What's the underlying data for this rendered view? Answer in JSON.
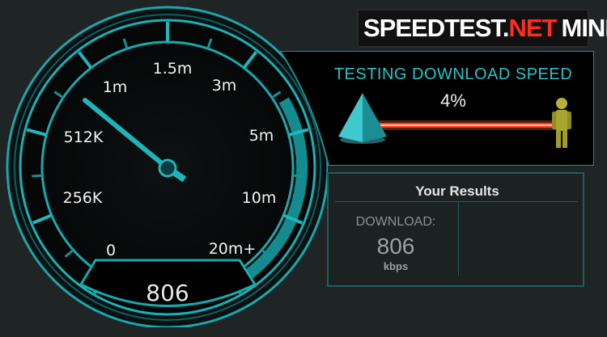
{
  "brand": {
    "part1": "SPEEDTEST.",
    "part2": "NET",
    "part3": "MINI"
  },
  "gauge": {
    "scale_labels": [
      "0",
      "256K",
      "512K",
      "1m",
      "1.5m",
      "3m",
      "5m",
      "10m",
      "20m+"
    ],
    "readout": "806",
    "accent_color": "#19b9bf"
  },
  "status": {
    "label": "TESTING DOWNLOAD SPEED",
    "percent_text": "4%",
    "progress": 0.04
  },
  "results": {
    "title": "Your Results",
    "download_label": "DOWNLOAD:",
    "download_value": "806",
    "download_unit": "kbps"
  },
  "icons": [
    "pyramid-icon",
    "person-icon"
  ]
}
